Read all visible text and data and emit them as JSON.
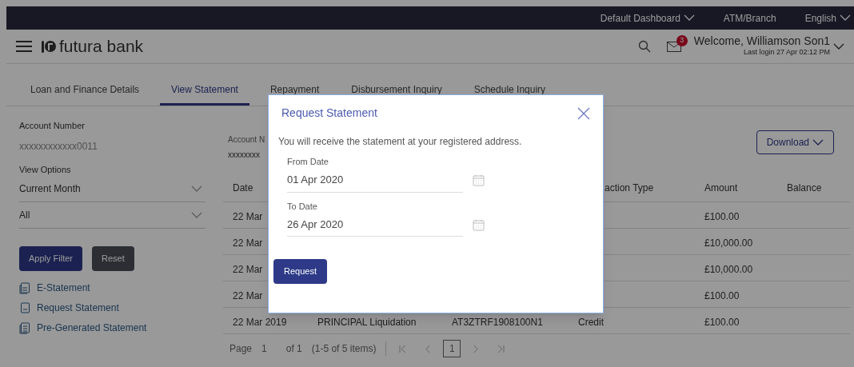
{
  "top_bar": {
    "links": [
      {
        "label": "Default Dashboard",
        "has_dropdown": true
      },
      {
        "label": "ATM/Branch",
        "has_dropdown": false
      },
      {
        "label": "English",
        "has_dropdown": true
      }
    ]
  },
  "header": {
    "brand": "futura bank",
    "notification_count": "3",
    "welcome": "Welcome, Williamson Son1",
    "last_login": "Last login 27 Apr 02:12 PM"
  },
  "tabs": [
    {
      "label": "Loan and Finance Details",
      "selected": false
    },
    {
      "label": "View Statement",
      "selected": true
    },
    {
      "label": "Repayment",
      "selected": false
    },
    {
      "label": "Disbursement Inquiry",
      "selected": false
    },
    {
      "label": "Schedule Inquiry",
      "selected": false
    }
  ],
  "sidebar": {
    "account_label": "Account Number",
    "account_number": "xxxxxxxxxxxx0011",
    "view_options_label": "View Options",
    "selects": [
      {
        "value": "Current Month"
      },
      {
        "value": "All"
      }
    ],
    "buttons": [
      {
        "label": "Apply Filter",
        "kind": "primary"
      },
      {
        "label": "Reset",
        "kind": "secondary"
      }
    ],
    "links": [
      {
        "label": "E-Statement",
        "kind": "e-statement"
      },
      {
        "label": "Request Statement",
        "kind": "request"
      },
      {
        "label": "Pre-Generated Statement",
        "kind": "pregenerated"
      }
    ]
  },
  "main": {
    "account_label": "Account N",
    "account_value": "xxxxxxxx",
    "download": "Download",
    "columns": [
      "Date",
      "action Type",
      "Amount",
      "Balance"
    ],
    "rows": [
      {
        "date": "22 Mar",
        "amount": "£100.00"
      },
      {
        "date": "22 Mar",
        "amount": "£10,000.00"
      },
      {
        "date": "22 Mar",
        "amount": "£10,000.00"
      },
      {
        "date": "22 Mar",
        "amount": "£100.00"
      },
      {
        "date": "22 Mar 2019",
        "description": "PRINCIPAL Liquidation",
        "reference": "AT3ZTRF1908100N1",
        "type": "Credit",
        "amount": "£100.00"
      }
    ],
    "pagination": {
      "page_label": "Page",
      "page": "1",
      "of": "of 1",
      "items": "(1-5 of 5 items)",
      "current": "1"
    }
  },
  "modal": {
    "title": "Request Statement",
    "message": "You will receive the statement at your registered address.",
    "fields": [
      {
        "label": "From Date",
        "value": "01 Apr 2020"
      },
      {
        "label": "To Date",
        "value": "26 Apr 2020"
      }
    ],
    "button": "Request"
  }
}
